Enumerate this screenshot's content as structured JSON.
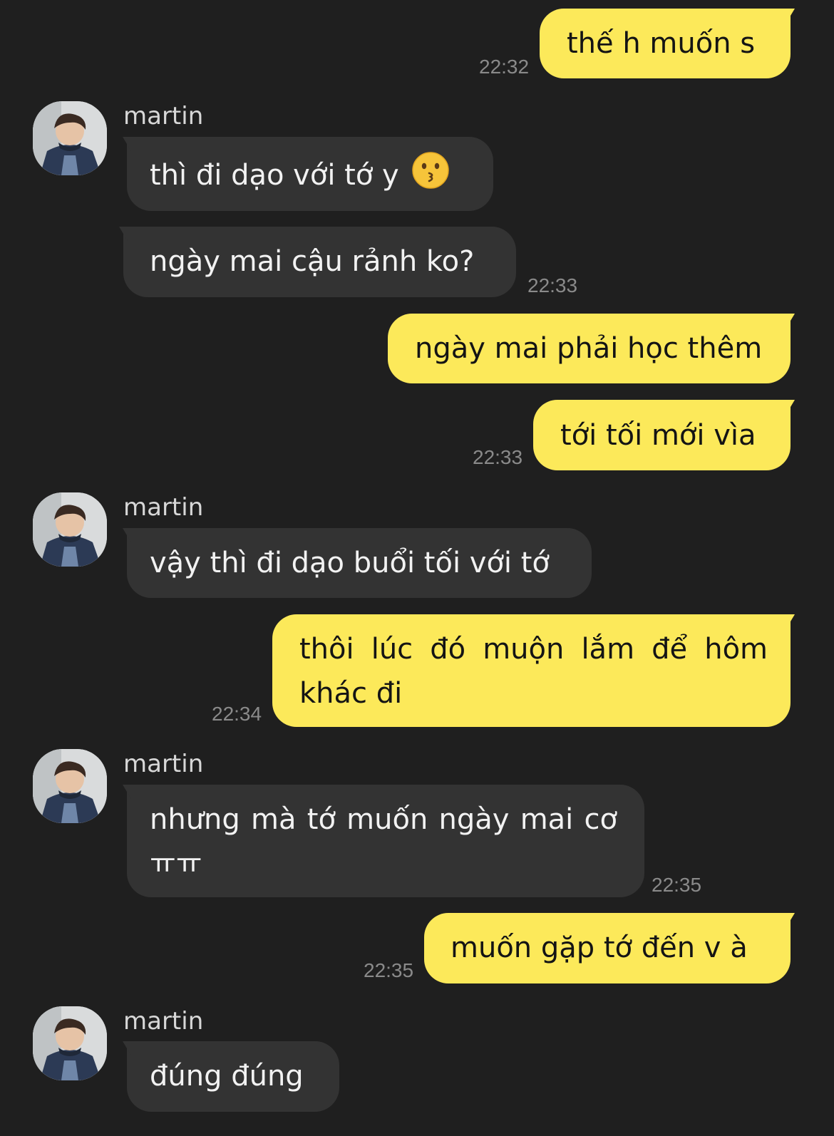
{
  "chat": {
    "contact_name": "martin",
    "messages": [
      {
        "text": "thế h muốn s",
        "time": "22:32"
      },
      {
        "sender": "martin",
        "text": "thì đi dạo với tớ y",
        "emoji": "kissing-face-icon"
      },
      {
        "text": "ngày mai cậu rảnh ko?",
        "time": "22:33"
      },
      {
        "text": "ngày mai phải học thêm"
      },
      {
        "text": "tới tối mới vìa",
        "time": "22:33"
      },
      {
        "sender": "martin",
        "text": "vậy thì đi dạo buổi tối với tớ"
      },
      {
        "text": "thôi lúc đó muộn lắm để hôm khác đi",
        "time": "22:34"
      },
      {
        "sender": "martin",
        "text": "nhưng mà tớ muốn ngày mai cơ ㅠㅠ",
        "time": "22:35"
      },
      {
        "text": "muốn gặp tớ đến v à",
        "time": "22:35"
      },
      {
        "sender": "martin",
        "text": "đúng đúng"
      }
    ]
  },
  "colors": {
    "background": "#1f1f1f",
    "outgoing_bubble": "#fce95a",
    "incoming_bubble": "#333333",
    "timestamp": "#8a8a8a"
  }
}
